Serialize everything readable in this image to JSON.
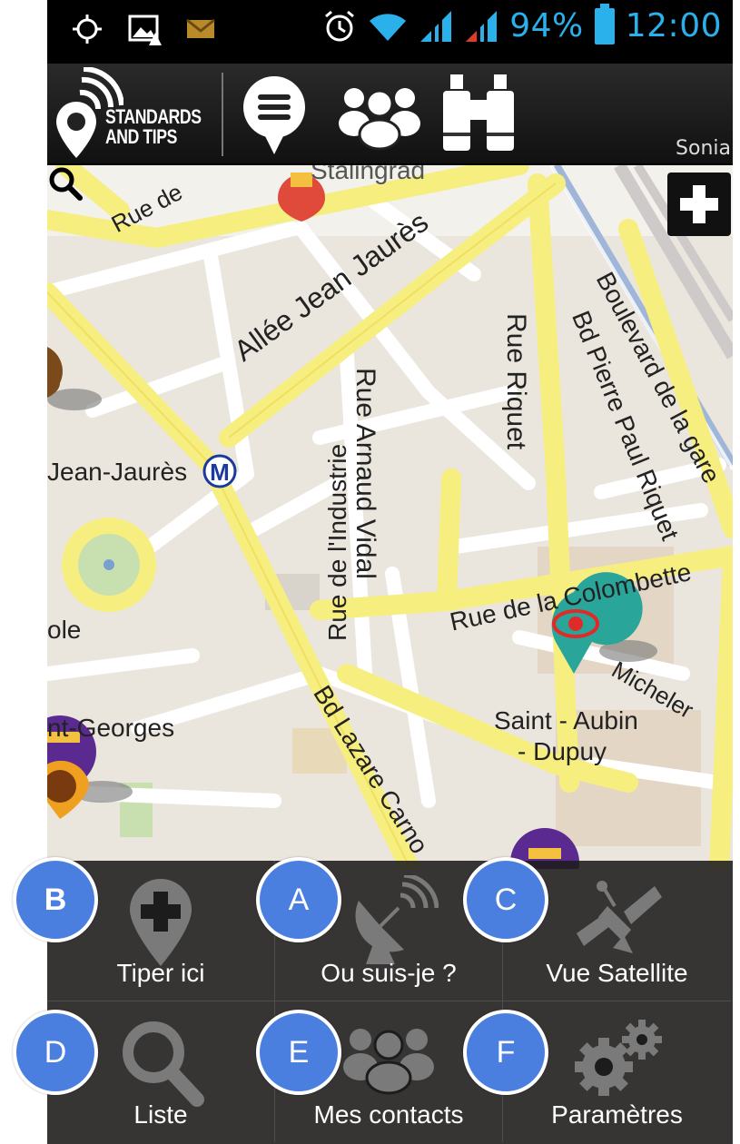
{
  "statusbar": {
    "battery_pct": "94%",
    "time": "12:00"
  },
  "header": {
    "logo_line1": "STANDARDS",
    "logo_line2": "AND TIPS",
    "username": "Sonia"
  },
  "map": {
    "streets": [
      "Rue de",
      "Stalingrad",
      "Allée Jean Jaurès",
      "Rue Arnaud Vidal",
      "Rue Riquet",
      "Bd Pierre Paul Riquet",
      "Boulevard de la gare",
      "Rue de l'Industrie",
      "Rue de la Colombette",
      "Bd Lazare Carno",
      "Micheler"
    ],
    "places": {
      "metro_jean_jaures": "Jean-Jaurès",
      "left_partial": "ole",
      "saint_georges": "nt-Georges",
      "saint_aubin_line1": "Saint - Aubin",
      "saint_aubin_line2": "- Dupuy"
    },
    "metro_symbol": "M"
  },
  "menu": {
    "items": [
      {
        "marker": "B",
        "label": "Tiper ici"
      },
      {
        "marker": "A",
        "label": "Ou suis-je ?"
      },
      {
        "marker": "C",
        "label": "Vue Satellite"
      },
      {
        "marker": "D",
        "label": "Liste"
      },
      {
        "marker": "E",
        "label": "Mes contacts"
      },
      {
        "marker": "F",
        "label": "Paramètres"
      }
    ]
  },
  "colors": {
    "accent_blue": "#2ab0ea",
    "marker_blue": "#4a7fe0",
    "road_yellow": "#f9f28a",
    "map_bg": "#eae5dc"
  }
}
